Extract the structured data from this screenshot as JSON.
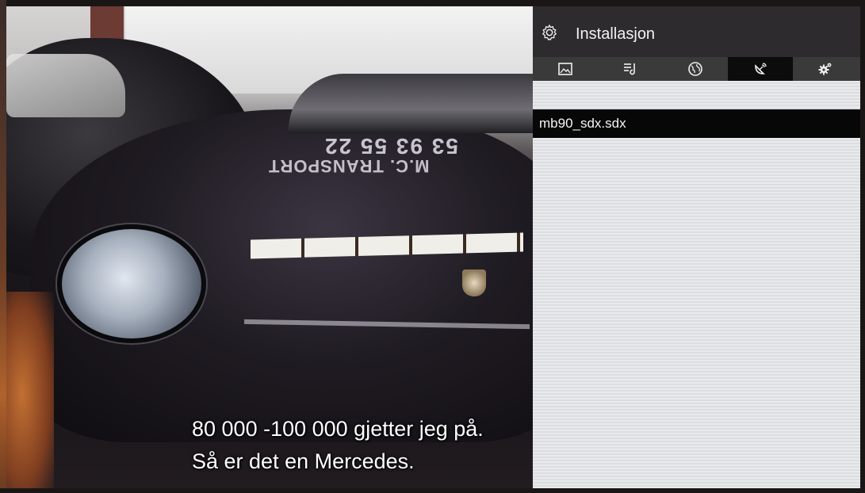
{
  "video": {
    "subtitle_line1": "80 000 -100 000 gjetter jeg på.",
    "subtitle_line2": "Så er det en Mercedes.",
    "hood_number": "53 93 55 22",
    "hood_company": "M.C. TRANSPORT"
  },
  "menu": {
    "title": "Installasjon",
    "title_icon": "gear-icon",
    "tabs": [
      {
        "icon": "picture-icon",
        "active": false
      },
      {
        "icon": "sound-icon",
        "active": false
      },
      {
        "icon": "globe-icon",
        "active": false
      },
      {
        "icon": "satellite-icon",
        "active": true
      },
      {
        "icon": "settings-icon",
        "active": false
      }
    ],
    "items": [
      {
        "label": "mb90_sdx.sdx",
        "selected": true
      }
    ]
  },
  "colors": {
    "panel_header_bg": "#2d2b2e",
    "tab_bar_bg": "#3a3a3a",
    "active_tab_bg": "#0c0c0c",
    "selected_item_bg": "#070707",
    "panel_bg": "#e3e4e6"
  }
}
